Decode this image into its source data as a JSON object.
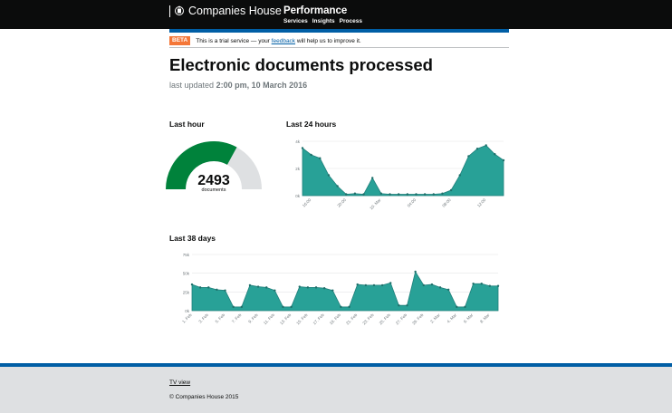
{
  "header": {
    "brand": "Companies House",
    "product": "Performance",
    "nav": [
      "Services",
      "Insights",
      "Process"
    ]
  },
  "banner": {
    "tag": "BETA",
    "text_before": "This is a trial service — your",
    "link": "feedback",
    "text_after": "will help us to improve it."
  },
  "page": {
    "title": "Electronic documents processed",
    "updated_prefix": "last updated",
    "updated_value": "2:00 pm, 10 March 2016"
  },
  "last_hour": {
    "heading": "Last hour",
    "value": "2493",
    "unit": "documents",
    "fill_fraction": 0.66
  },
  "colors": {
    "accent": "#005ea5",
    "gauge_fill": "#00823b",
    "gauge_track": "#dee0e2",
    "area": "#28a197",
    "beta": "#f47738"
  },
  "chart_data": [
    {
      "type": "area",
      "title": "Last 24 hours",
      "ylim": [
        0,
        4000
      ],
      "y_ticks": [
        "4k",
        "2k",
        "0k"
      ],
      "x_tick_labels": [
        "16:00",
        "20:00",
        "10. Mar",
        "04:00",
        "08:00",
        "12:00"
      ],
      "x_tick_index": [
        1,
        5,
        9,
        13,
        17,
        21
      ],
      "values": [
        3500,
        3000,
        2750,
        1500,
        700,
        100,
        150,
        100,
        1300,
        150,
        100,
        100,
        100,
        100,
        100,
        100,
        150,
        400,
        1500,
        2900,
        3450,
        3700,
        3050,
        2600
      ],
      "grid": true
    },
    {
      "type": "area",
      "title": "Last 38 days",
      "ylim": [
        0,
        75000
      ],
      "y_ticks": [
        "75k",
        "50k",
        "25k",
        "0k"
      ],
      "x_tick_labels": [
        "1. Feb",
        "3. Feb",
        "5. Feb",
        "7. Feb",
        "9. Feb",
        "11. Feb",
        "13. Feb",
        "15. Feb",
        "17. Feb",
        "19. Feb",
        "21. Feb",
        "23. Feb",
        "25. Feb",
        "27. Feb",
        "29. Feb",
        "2. Mar",
        "4. Mar",
        "6. Mar",
        "8. Mar"
      ],
      "x_tick_index": [
        0,
        2,
        4,
        6,
        8,
        10,
        12,
        14,
        16,
        18,
        20,
        22,
        24,
        26,
        28,
        30,
        32,
        34,
        36
      ],
      "values": [
        35000,
        31000,
        31000,
        28000,
        27000,
        5000,
        5000,
        34000,
        32000,
        31000,
        27000,
        5000,
        5000,
        32000,
        31000,
        31000,
        30000,
        27000,
        5000,
        5000,
        35000,
        34000,
        34000,
        34000,
        37000,
        7000,
        7000,
        52000,
        34000,
        35000,
        31000,
        28000,
        5000,
        5000,
        36000,
        36000,
        33000,
        33000
      ],
      "grid": true
    }
  ],
  "footer": {
    "tv_view": "TV view",
    "copyright": "© Companies House 2015"
  }
}
